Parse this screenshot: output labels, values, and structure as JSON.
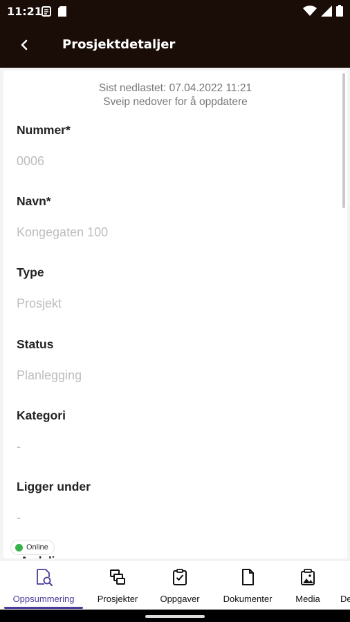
{
  "status_bar": {
    "time": "11:21"
  },
  "app_bar": {
    "title": "Prosjektdetaljer"
  },
  "sync": {
    "last_downloaded": "Sist nedlastet: 07.04.2022 11:21",
    "hint": "Sveip nedover for å oppdatere"
  },
  "fields": [
    {
      "label": "Nummer*",
      "value": "0006"
    },
    {
      "label": "Navn*",
      "value": "Kongegaten 100"
    },
    {
      "label": "Type",
      "value": "Prosjekt"
    },
    {
      "label": "Status",
      "value": "Planlegging"
    },
    {
      "label": "Kategori",
      "value": "-"
    },
    {
      "label": "Ligger under",
      "value": "-"
    }
  ],
  "next_field_label": "Avdeling",
  "connection": {
    "label": "Online",
    "color": "#34b34a"
  },
  "bottom_nav": {
    "items": [
      {
        "label": "Oppsummering",
        "icon": "summary-search-icon",
        "active": true
      },
      {
        "label": "Prosjekter",
        "icon": "projects-icon"
      },
      {
        "label": "Oppgaver",
        "icon": "tasks-icon"
      },
      {
        "label": "Dokumenter",
        "icon": "document-icon"
      },
      {
        "label": "Media",
        "icon": "media-icon"
      },
      {
        "label": "De",
        "icon": "more-icon"
      }
    ]
  },
  "colors": {
    "app_bar": "#1a0d08",
    "accent": "#4a3b9a",
    "placeholder": "#bdbdbd"
  }
}
